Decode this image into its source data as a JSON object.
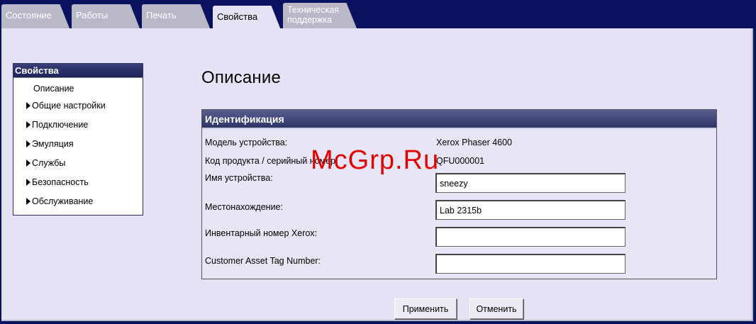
{
  "tabs": [
    {
      "label": "Состояние",
      "active": false
    },
    {
      "label": "Работы",
      "active": false
    },
    {
      "label": "Печать",
      "active": false
    },
    {
      "label": "Свойства",
      "active": true
    },
    {
      "label": "Техническая поддержка",
      "active": false
    }
  ],
  "sidebar": {
    "header": "Свойства",
    "items": [
      {
        "label": "Описание"
      },
      {
        "label": "Общие настройки"
      },
      {
        "label": "Подключение"
      },
      {
        "label": "Эмуляция"
      },
      {
        "label": "Службы"
      },
      {
        "label": "Безопасность"
      },
      {
        "label": "Обслуживание"
      }
    ]
  },
  "main": {
    "title": "Описание",
    "panel_title": "Идентификация",
    "rows": [
      {
        "label": "Модель устройства:",
        "value": "Xerox Phaser 4600"
      },
      {
        "label": "Код продукта / серийный номер:",
        "value": "QFU000001"
      },
      {
        "label": "Имя устройства:",
        "field_value": "sneezy"
      },
      {
        "label": "Местонахождение:",
        "field_value": "Lab 2315b"
      },
      {
        "label": "Инвентарный номер Xerox:",
        "field_value": ""
      },
      {
        "label": "Customer Asset Tag Number:",
        "field_value": ""
      }
    ]
  },
  "buttons": {
    "apply": "Применить",
    "cancel": "Отменить"
  },
  "watermark": "McGrp.Ru"
}
